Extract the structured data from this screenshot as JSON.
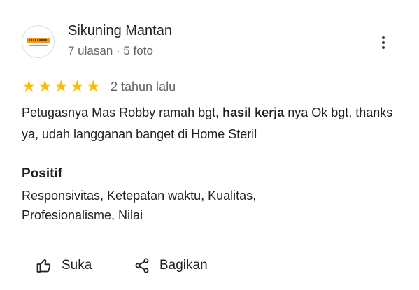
{
  "reviewer": {
    "name": "Sikuning Mantan",
    "meta": "7 ulasan · 5 foto",
    "avatar_icon": "business-logo-avatar"
  },
  "menu": {
    "icon": "more-vertical-icon"
  },
  "rating": {
    "stars": 5,
    "max_stars": 5,
    "star_color": "#fbbc04",
    "time": "2 tahun lalu"
  },
  "review": {
    "text_before": "Petugasnya Mas Robby ramah bgt, ",
    "text_bold": "hasil kerja",
    "text_after": " nya Ok bgt, thanks ya, udah langganan banget di Home Steril"
  },
  "positive": {
    "title": "Positif",
    "items": "Responsivitas, Ketepatan waktu, Kualitas, Profesionalisme, Nilai"
  },
  "actions": {
    "like_label": "Suka",
    "like_icon": "thumbs-up-icon",
    "share_label": "Bagikan",
    "share_icon": "share-icon"
  }
}
